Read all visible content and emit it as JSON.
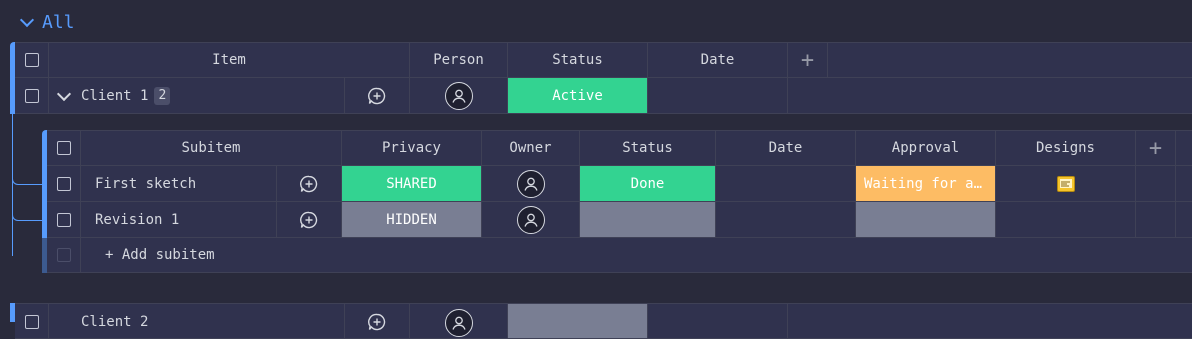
{
  "group": {
    "title": "All"
  },
  "header": {
    "item": "Item",
    "person": "Person",
    "status": "Status",
    "date": "Date",
    "add": "+"
  },
  "items": [
    {
      "name": "Client 1",
      "subitem_count": "2",
      "status": "Active",
      "status_color": "#33d391"
    },
    {
      "name": "Client 2",
      "status": "",
      "status_color": "#797e93"
    }
  ],
  "sub_header": {
    "subitem": "Subitem",
    "privacy": "Privacy",
    "owner": "Owner",
    "status": "Status",
    "date": "Date",
    "approval": "Approval",
    "designs": "Designs",
    "add": "+"
  },
  "subitems": [
    {
      "name": "First sketch",
      "privacy": "SHARED",
      "privacy_color": "#33d391",
      "status": "Done",
      "status_color": "#33d391",
      "approval": "Waiting for a…",
      "approval_color": "#fdbc64"
    },
    {
      "name": "Revision 1",
      "privacy": "HIDDEN",
      "privacy_color": "#797e93",
      "status": "",
      "status_color": "#797e93",
      "approval": "",
      "approval_color": "#797e93"
    }
  ],
  "add_subitem": "+ Add subitem"
}
